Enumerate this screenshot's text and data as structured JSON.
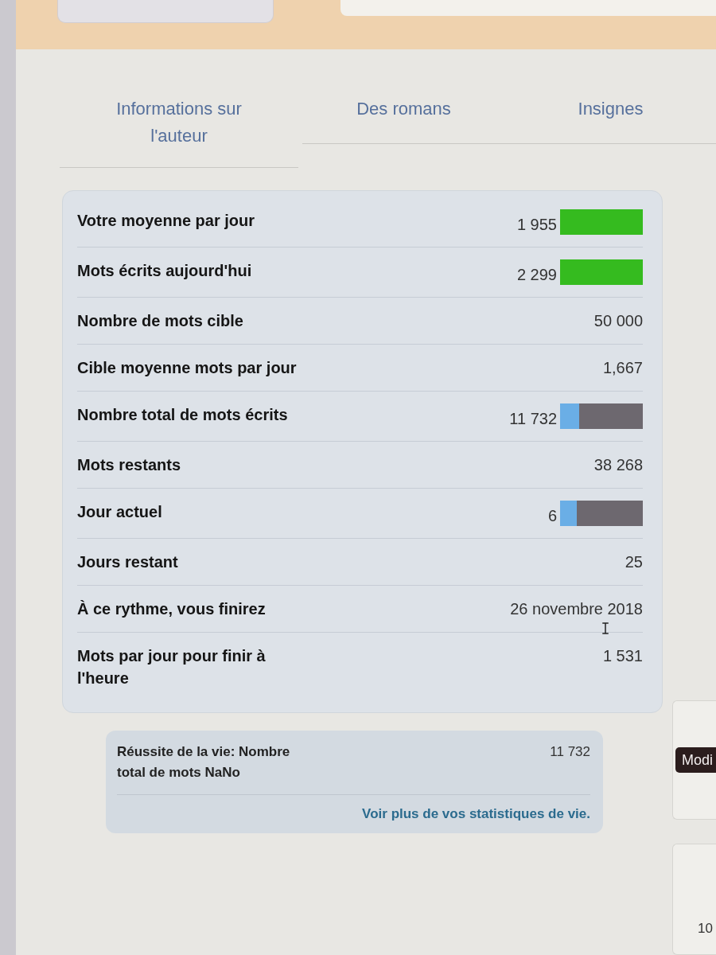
{
  "tabs": [
    {
      "label": "Informations sur l'auteur",
      "selected": false
    },
    {
      "label": "Des romans",
      "selected": false
    },
    {
      "label": "Insignes",
      "selected": false
    }
  ],
  "stats": [
    {
      "kind": "meter",
      "label": "Votre moyenne par jour",
      "value": "1 955",
      "level": 1,
      "color": "#35bb1f"
    },
    {
      "kind": "meter",
      "label": "Mots écrits aujourd'hui",
      "value": "2 299",
      "level": 1,
      "color": "#35bb1f"
    },
    {
      "kind": "text",
      "label": "Nombre de mots cible",
      "value": "50 000"
    },
    {
      "kind": "text",
      "label": "Cible moyenne mots par jour",
      "value": "1,667"
    },
    {
      "kind": "meter",
      "label": "Nombre total de mots écrits",
      "value": "11 732",
      "level": 0.23,
      "color": "#6aaee6"
    },
    {
      "kind": "text",
      "label": "Mots restants",
      "value": "38 268"
    },
    {
      "kind": "meter",
      "label": "Jour actuel",
      "value": "6",
      "level": 0.2,
      "color": "#6aaee6"
    },
    {
      "kind": "text",
      "label": "Jours restant",
      "value": "25"
    },
    {
      "kind": "text",
      "label": "À ce rythme, vous finirez",
      "value": "26 novembre 2018"
    },
    {
      "kind": "text",
      "label": "Mots par jour pour finir à l'heure",
      "value": "1 531"
    }
  ],
  "lifetime": {
    "label": "Réussite de la vie: Nombre total de mots NaNo",
    "value": "11 732",
    "link": "Voir plus de vos statistiques de vie."
  },
  "side": {
    "button": "Modi",
    "number": "10"
  }
}
